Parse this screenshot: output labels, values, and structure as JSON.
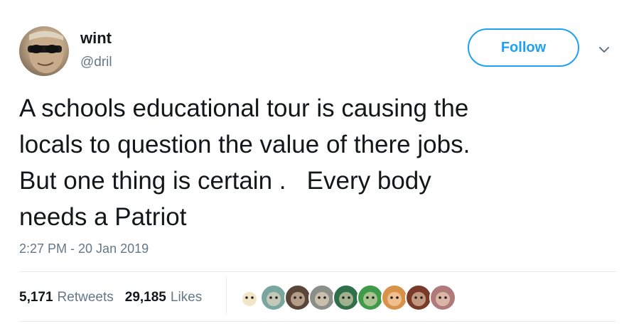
{
  "author": {
    "display_name": "wint",
    "handle": "@dril",
    "avatar_icon": "profile-photo-sunglasses-man"
  },
  "follow_label": "Follow",
  "menu_icon": "chevron-down-icon",
  "tweet": {
    "text": "A schools educational tour is causing the\nlocals to question the value of there jobs.\nBut one thing is certain .   Every body\nneeds a Patriot",
    "timestamp": "2:27 PM - 20 Jan 2019"
  },
  "stats": {
    "retweets_count": "5,171",
    "retweets_label": "Retweets",
    "likes_count": "29,185",
    "likes_label": "Likes"
  },
  "likers": [
    {
      "icon": "cartoon-face-avatar",
      "bg": "#ffffff"
    },
    {
      "icon": "colorful-face-avatar",
      "bg": "#7aa6a0"
    },
    {
      "icon": "dark-face-avatar",
      "bg": "#5a4638"
    },
    {
      "icon": "character-avatar",
      "bg": "#8a8f8a"
    },
    {
      "icon": "sticker-avatar",
      "bg": "#2f6f4a"
    },
    {
      "icon": "green-creature-avatar",
      "bg": "#3f9a4a"
    },
    {
      "icon": "dog-sunglasses-avatar",
      "bg": "#d9924a"
    },
    {
      "icon": "red-face-avatar",
      "bg": "#7a3a2a"
    },
    {
      "icon": "person-avatar",
      "bg": "#b07a7a"
    }
  ],
  "colors": {
    "accent": "#1da1f2",
    "text": "#14171a",
    "secondary_text": "#657786",
    "divider": "#e6ecf0"
  }
}
